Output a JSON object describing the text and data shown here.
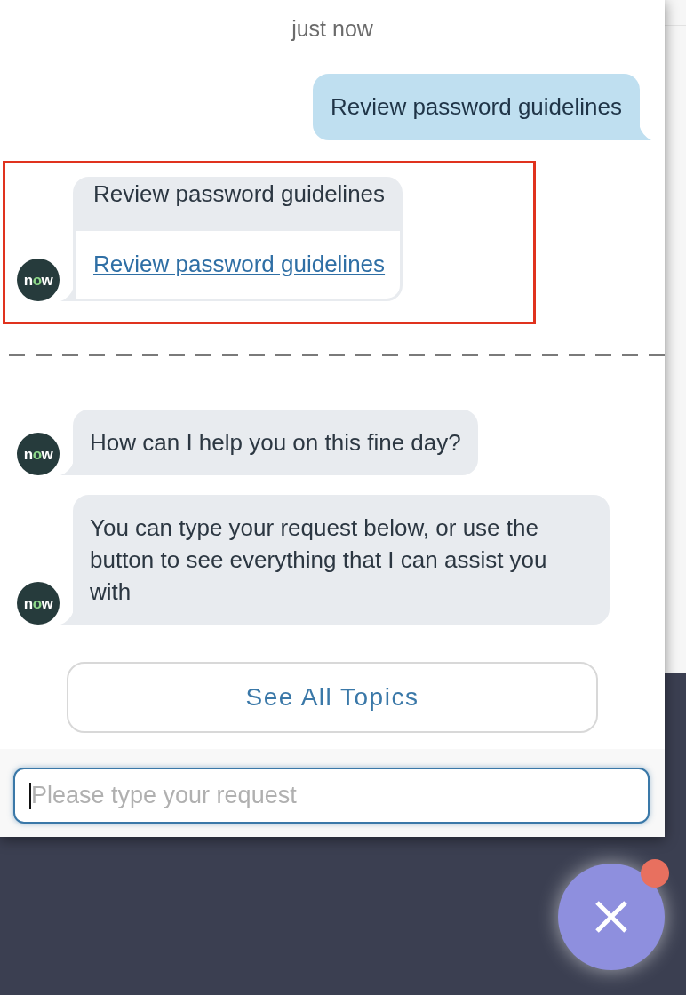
{
  "timestamp": "just now",
  "messages": [
    {
      "kind": "user",
      "highlighted": false,
      "text": "Review password guidelines"
    },
    {
      "kind": "card",
      "highlighted": true,
      "avatar": "now",
      "title": "Review password guidelines",
      "link": "Review password guidelines"
    },
    {
      "kind": "divider"
    },
    {
      "kind": "bot",
      "highlighted": false,
      "avatar": "now",
      "text": "How can I help you on this fine day?"
    },
    {
      "kind": "bot",
      "highlighted": false,
      "avatar": "now",
      "text": "You can type your request below, or use the button to see everything that I can assist you with"
    }
  ],
  "topics_button": "See All Topics",
  "input": {
    "placeholder": "Please type your request",
    "focused": true
  },
  "launcher": {
    "notification": true
  }
}
